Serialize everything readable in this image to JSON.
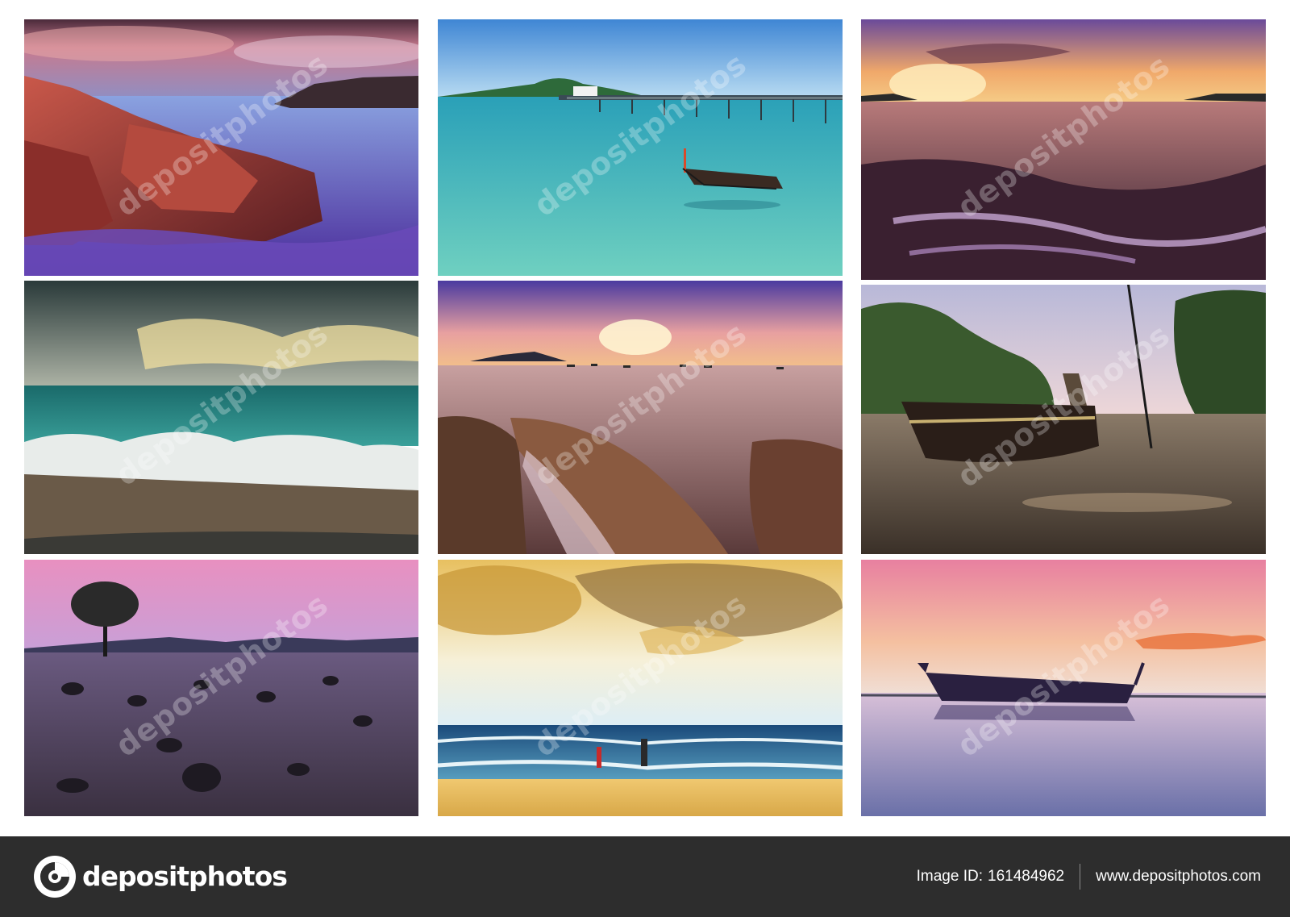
{
  "watermark": {
    "text": "depositphotos"
  },
  "photos": [
    {
      "subject": "red-rocks-purple-sea"
    },
    {
      "subject": "pier-longtail-boat"
    },
    {
      "subject": "sunset-rocky-shore"
    },
    {
      "subject": "storm-waves-beach"
    },
    {
      "subject": "sunset-rocks-boats"
    },
    {
      "subject": "boat-mangrove-sunset"
    },
    {
      "subject": "lone-tree-rocky-beach"
    },
    {
      "subject": "golden-sky-surf-people"
    },
    {
      "subject": "boat-reflection-dusk"
    }
  ],
  "footer": {
    "brand": "depositphotos",
    "image_id_label": "Image ID:",
    "image_id": "161484962",
    "website": "www.depositphotos.com",
    "background_color": "#2d2d2d"
  }
}
